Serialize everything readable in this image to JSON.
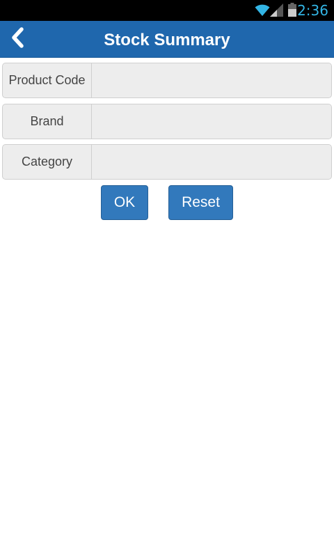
{
  "status_bar": {
    "time": "2:36",
    "icons": [
      "wifi-icon",
      "signal-icon",
      "battery-icon"
    ],
    "accent_color": "#33b5e5"
  },
  "header": {
    "title": "Stock Summary",
    "back_icon": "chevron-left-icon",
    "background_color": "#1f67ad"
  },
  "form": {
    "fields": [
      {
        "label": "Product Code",
        "value": "",
        "placeholder": ""
      },
      {
        "label": "Brand",
        "value": "",
        "placeholder": ""
      },
      {
        "label": "Category",
        "value": "",
        "placeholder": ""
      }
    ],
    "ok_label": "OK",
    "reset_label": "Reset",
    "button_color": "#3279bc"
  }
}
